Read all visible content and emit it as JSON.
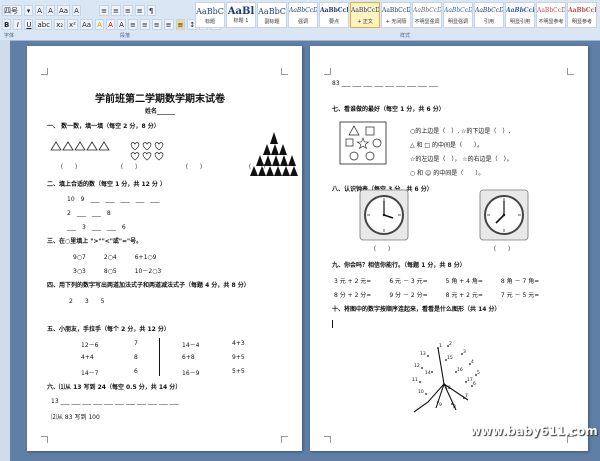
{
  "toolbar": {
    "font_size": "四号",
    "row1": [
      "▾",
      "A",
      "A",
      "Aa",
      "A",
      "≡",
      "≡",
      "≡",
      "≡",
      "¶"
    ],
    "row2": [
      "B",
      "I",
      "U",
      "abc",
      "x₂",
      "x²",
      "Aa",
      "A",
      "A",
      "A",
      "≡",
      "≡",
      "≡",
      "≡",
      "≡",
      "↕",
      "A",
      "▦"
    ],
    "group_font": "字体",
    "group_paragraph": "段落",
    "group_styles": "样式"
  },
  "styles": [
    {
      "sample": "AaBbC",
      "name": "标题"
    },
    {
      "sample": "AaBl",
      "name": "标题 1"
    },
    {
      "sample": "AaBbC",
      "name": "副标题"
    },
    {
      "sample": "AaBbCcD",
      "name": "强调"
    },
    {
      "sample": "AaBbCcD",
      "name": "要点"
    },
    {
      "sample": "AaBbCcDı",
      "name": "+ 正文"
    },
    {
      "sample": "AaBbCcDı",
      "name": "+ 无间隔"
    },
    {
      "sample": "AaBbCcDı",
      "name": "不明显强调"
    },
    {
      "sample": "AaBbCcDı",
      "name": "明显强调"
    },
    {
      "sample": "AaBbCcDı",
      "name": "引用"
    },
    {
      "sample": "AaBbCcDı",
      "name": "明显引用"
    },
    {
      "sample": "AaBbCcDı",
      "name": "不明显参考"
    },
    {
      "sample": "AaBbCcI",
      "name": "明显参考"
    }
  ],
  "left": {
    "title": "学前班第二学期数学期末试卷",
    "name_line": "姓名______",
    "q1": "一、 数一数，填一填（每空 2 分，8 分）",
    "q1_blanks": [
      "（　　）",
      "（　　）",
      "（　　）",
      "（　　）"
    ],
    "q2": "二、填上合适的数（每空 1 分，共 12 分 ）",
    "q2_lines": [
      "10　9　___　___　___　___　___",
      "2　___　___　8",
      "___　3　___　___　6"
    ],
    "q3": "三、在○里填上 \">\"\"<\"或\"=\"号。",
    "q3_lines": [
      "9○7　　　2○4　　　6+1○9",
      "3○3　　　8○5　　　10－2○3"
    ],
    "q4": "四、用下列的数字写出两道加法式子和两道减法式子（每题 4 分，共 8 分）",
    "q4_numbers": "2　　3　　5",
    "q5": "五、小朋友，手拉手（每个 2 分，共 12 分）",
    "q5_left": [
      "12－6",
      "4+4",
      "14－7"
    ],
    "q5_mid": [
      "7",
      "8",
      "6"
    ],
    "q5_right": [
      "14－4",
      "6+8",
      "16－9"
    ],
    "q5_far": [
      "4+3",
      "9+5",
      "5+5"
    ],
    "q6": "六、⑴从 13 写到 24（每空 0.5 分，共 14 分）",
    "q6_line": "13 ___ ___ ___ ___ ___ ___ ___ ___ ___ ___ ___",
    "q6_2": "⑵从 83 写到 100"
  },
  "right": {
    "top_line": "83 ___ ___ ___ ___ ___ ___ ___ ___ ___",
    "q7": "七、看谁做的最好（每空 1 分，共 6 分）",
    "q7_lines": [
      "○的上边是（　）, ☆的下边是（　）,",
      "△ 和 □ 的中间是（　　）。",
      "☆的左边是（　）， ☆的右边是（　）。",
      "○ 和 ☺ 的中间是（　　）。"
    ],
    "q8": "八、认识钟表（每空 3 分，共 6 分）",
    "q8_blanks": [
      "（　　）",
      "（　　）"
    ],
    "q9": "九、你会吗？相信你能行。（每题 1 分，共 8 分）",
    "q9_lines": [
      "3 元 + 2 元=　　　6 元 － 3 元=　　　5 角 + 4 角=　　　8 角 － 7 角=",
      "8 分 + 2 分=　　　9 分 － 2 分=　　　8 元 + 2 元=　　　7 元 － 5 元="
    ],
    "q10": "十、将图中的数字按顺序连起来，看看是什么图形（共 14 分）",
    "dots": [
      "1",
      "2",
      "3",
      "4",
      "5",
      "6",
      "7",
      "8",
      "9",
      "10",
      "11",
      "12",
      "13",
      "14",
      "15",
      "16",
      "17",
      "18"
    ]
  },
  "watermark": "www.baby611.com"
}
